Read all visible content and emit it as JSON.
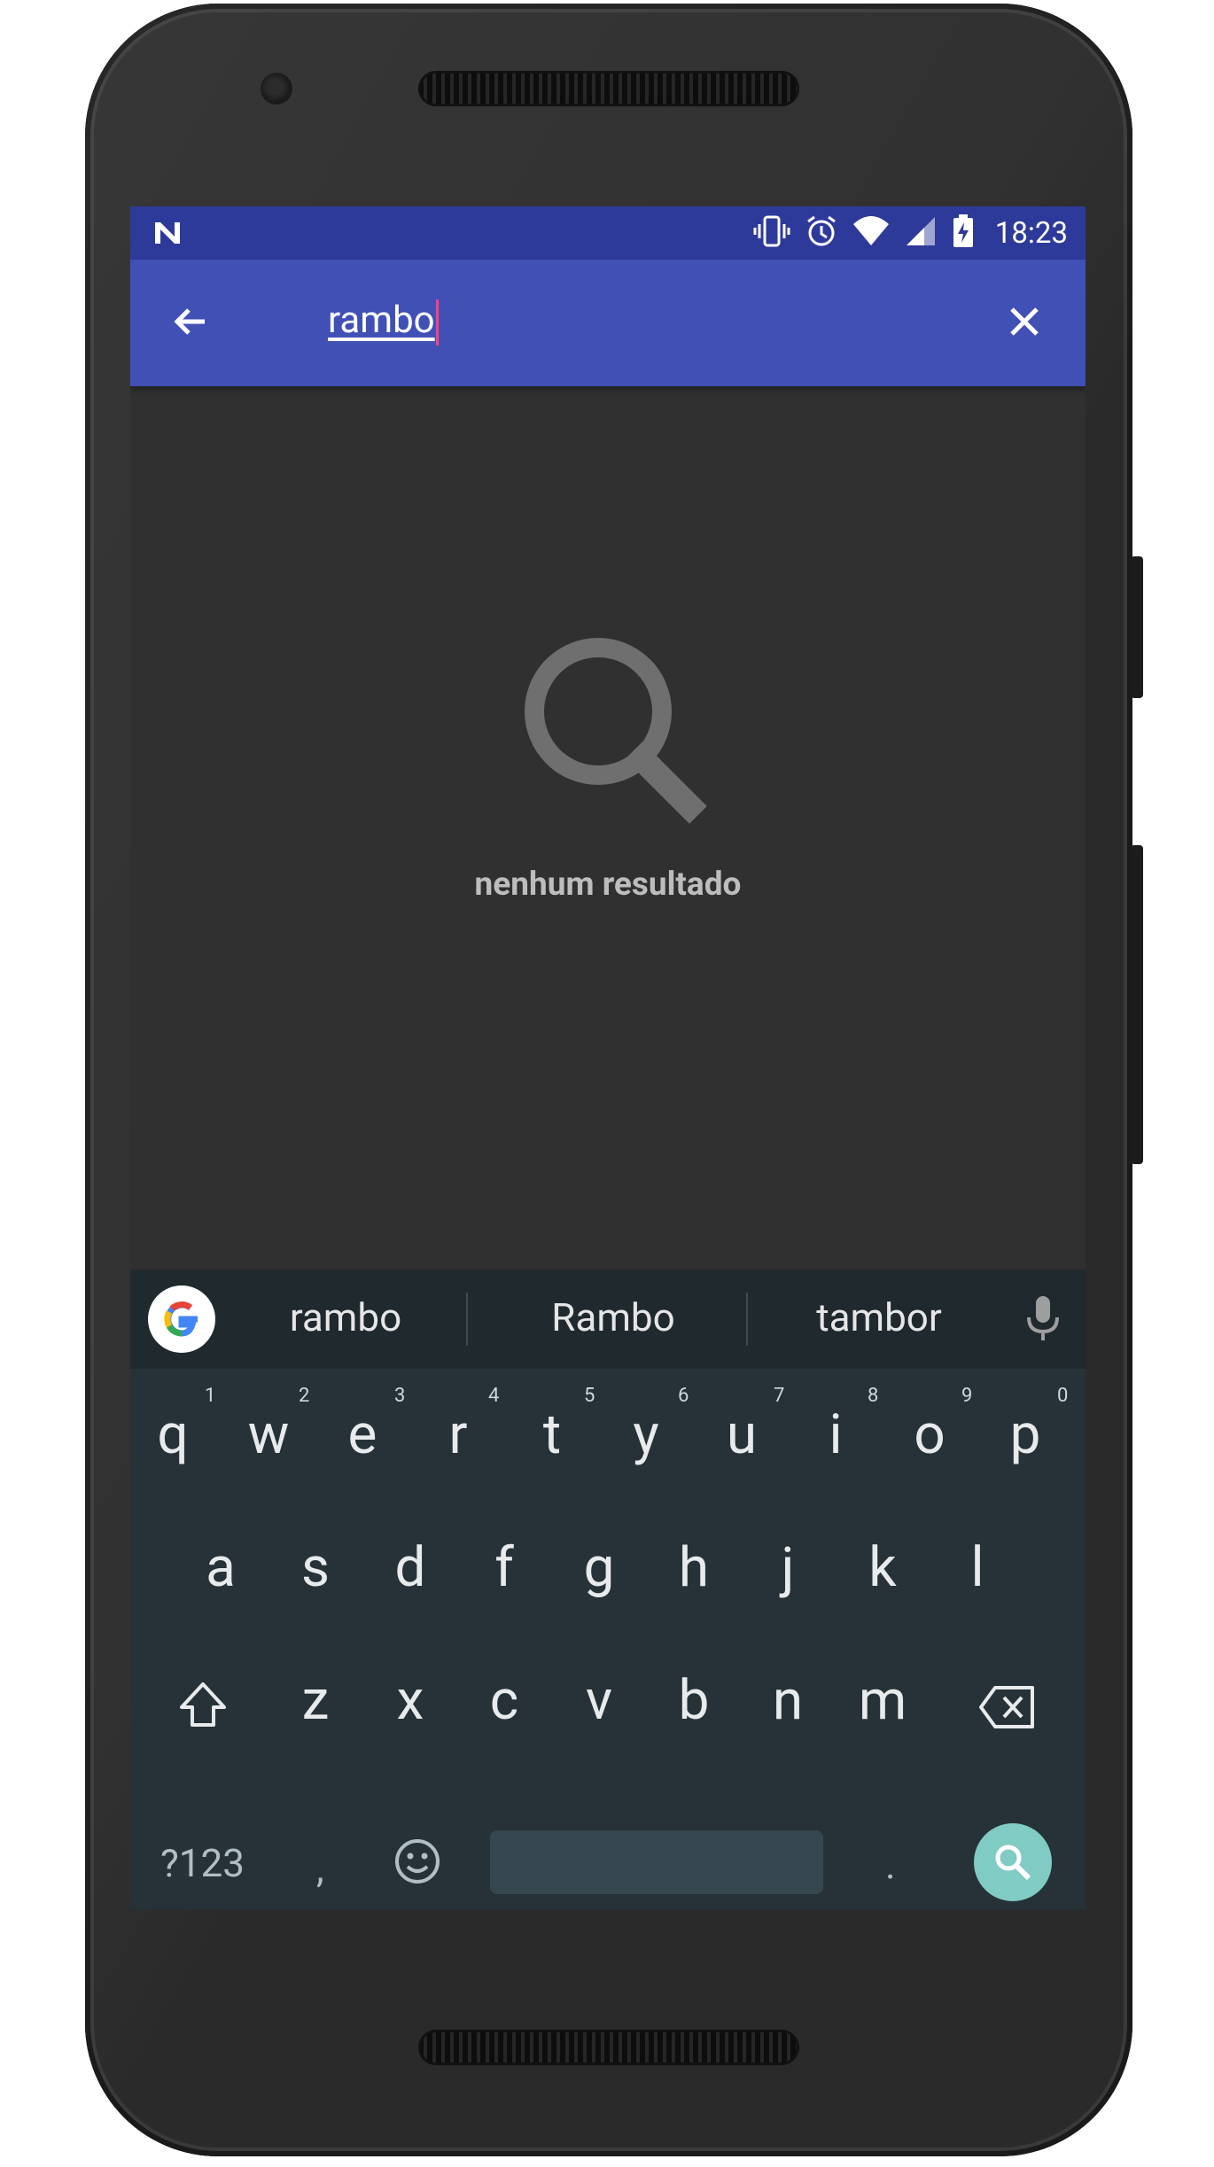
{
  "status_bar": {
    "time": "18:23",
    "icons": [
      "notification-n-icon",
      "vibrate-icon",
      "alarm-icon",
      "wifi-icon",
      "signal-icon",
      "battery-charging-icon"
    ],
    "color": "#2e3a9a"
  },
  "toolbar": {
    "query": "rambo",
    "color": "#4050b5",
    "caret_color": "#ff4081"
  },
  "empty_state": {
    "icon": "search-icon",
    "message": "nenhum resultado"
  },
  "keyboard": {
    "suggestions": [
      "rambo",
      "Rambo",
      "tambor"
    ],
    "row1": [
      "q",
      "w",
      "e",
      "r",
      "t",
      "y",
      "u",
      "i",
      "o",
      "p"
    ],
    "row1_hints": [
      "1",
      "2",
      "3",
      "4",
      "5",
      "6",
      "7",
      "8",
      "9",
      "0"
    ],
    "row2": [
      "a",
      "s",
      "d",
      "f",
      "g",
      "h",
      "j",
      "k",
      "l"
    ],
    "row3": [
      "z",
      "x",
      "c",
      "v",
      "b",
      "n",
      "m"
    ],
    "symbols_label": "?123",
    "comma": ",",
    "period": ".",
    "accent": "#80cbc4"
  }
}
